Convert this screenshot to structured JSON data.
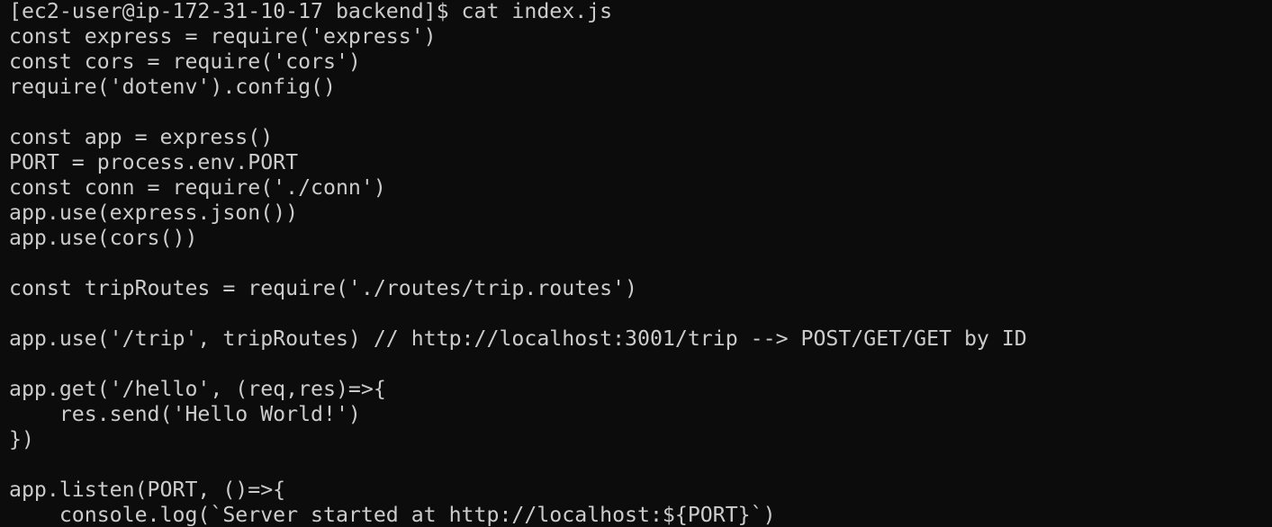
{
  "terminal": {
    "background": "#0c0c0c",
    "foreground": "#cccccc",
    "lines": [
      "[ec2-user@ip-172-31-10-17 backend]$ cat index.js",
      "const express = require('express')",
      "const cors = require('cors')",
      "require('dotenv').config()",
      "",
      "const app = express()",
      "PORT = process.env.PORT",
      "const conn = require('./conn')",
      "app.use(express.json())",
      "app.use(cors())",
      "",
      "const tripRoutes = require('./routes/trip.routes')",
      "",
      "app.use('/trip', tripRoutes) // http://localhost:3001/trip --> POST/GET/GET by ID",
      "",
      "app.get('/hello', (req,res)=>{",
      "    res.send('Hello World!')",
      "})",
      "",
      "app.listen(PORT, ()=>{",
      "    console.log(`Server started at http://localhost:${PORT}`)"
    ]
  }
}
